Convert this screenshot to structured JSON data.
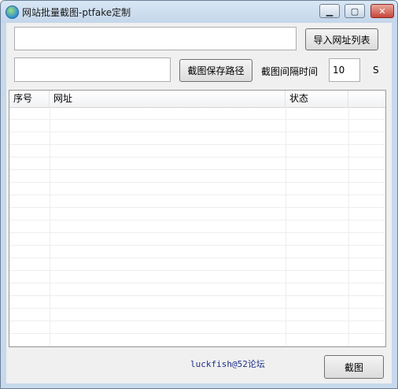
{
  "window": {
    "title": "网站批量截图-ptfake定制",
    "controls": {
      "minimize": "▁",
      "maximize": "▢",
      "close": "✕"
    }
  },
  "toolbar": {
    "url_list_path": "",
    "import_button_label": "导入网址列表",
    "save_path": "",
    "save_path_button_label": "截图保存路径",
    "interval_label": "截图间隔时间",
    "interval_value": "10",
    "interval_unit": "S"
  },
  "table": {
    "columns": [
      "序号",
      "网址",
      "状态",
      ""
    ],
    "rows": []
  },
  "footer": {
    "credit": "luckfish@52论坛",
    "screenshot_button_label": "截图"
  }
}
